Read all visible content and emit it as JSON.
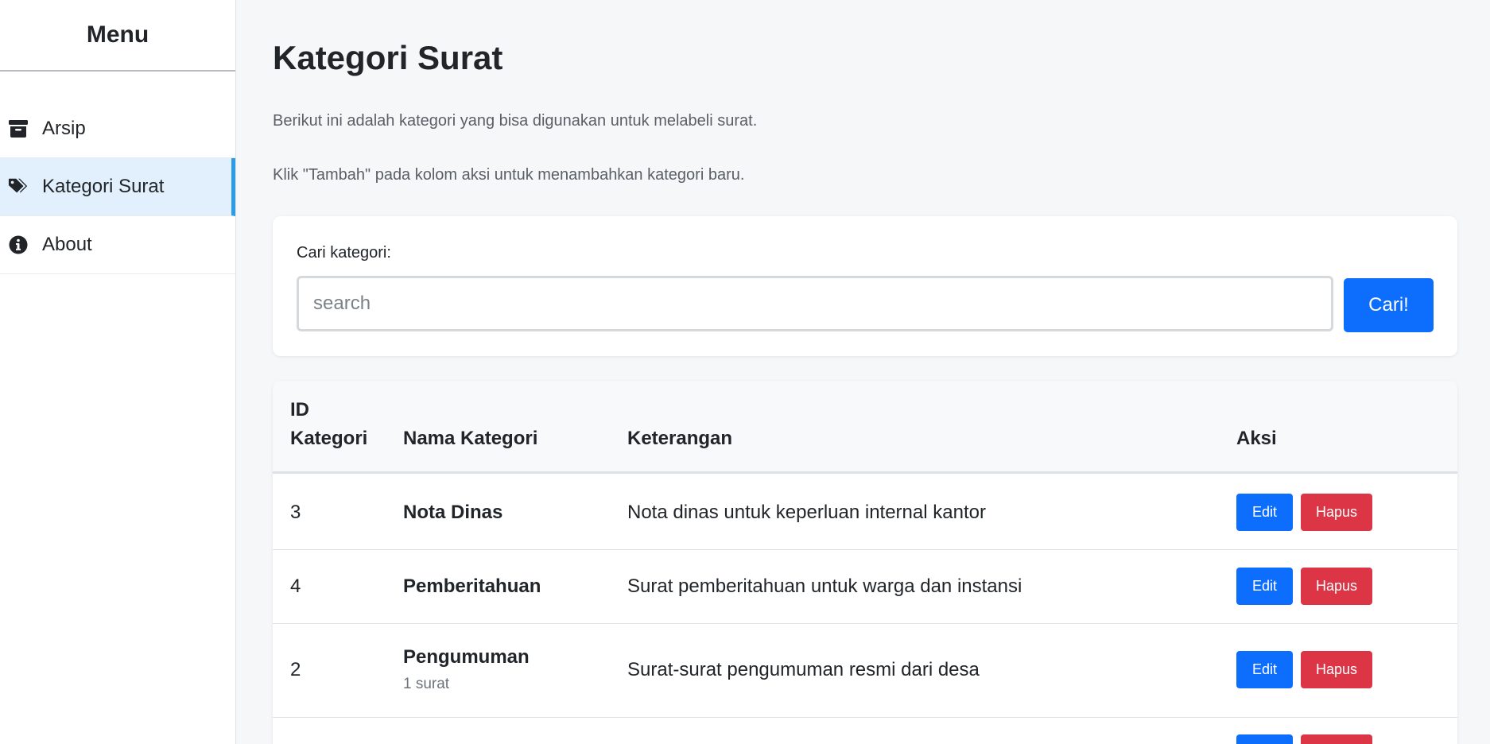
{
  "sidebar": {
    "title": "Menu",
    "items": [
      {
        "label": "Arsip",
        "icon": "archive-icon"
      },
      {
        "label": "Kategori Surat",
        "icon": "tags-icon",
        "active": true
      },
      {
        "label": "About",
        "icon": "info-icon"
      }
    ]
  },
  "page": {
    "title": "Kategori Surat",
    "desc1": "Berikut ini adalah kategori yang bisa digunakan untuk melabeli surat.",
    "desc2": "Klik \"Tambah\" pada kolom aksi untuk menambahkan kategori baru."
  },
  "search": {
    "label": "Cari kategori:",
    "placeholder": "search",
    "value": "",
    "button_label": "Cari!"
  },
  "table": {
    "headers": {
      "id": "ID Kategori",
      "name": "Nama Kategori",
      "desc": "Keterangan",
      "action": "Aksi"
    },
    "edit_label": "Edit",
    "delete_label": "Hapus",
    "rows": [
      {
        "id": "3",
        "name": "Nota Dinas",
        "count": "",
        "desc": "Nota dinas untuk keperluan internal kantor"
      },
      {
        "id": "4",
        "name": "Pemberitahuan",
        "count": "",
        "desc": "Surat pemberitahuan untuk warga dan instansi"
      },
      {
        "id": "2",
        "name": "Pengumuman",
        "count": "1 surat",
        "desc": "Surat-surat pengumuman resmi dari desa"
      }
    ]
  },
  "colors": {
    "accent": "#0d6efd",
    "danger": "#dc3545",
    "active_bg": "#e1f0fc",
    "active_border": "#2a9de6"
  }
}
